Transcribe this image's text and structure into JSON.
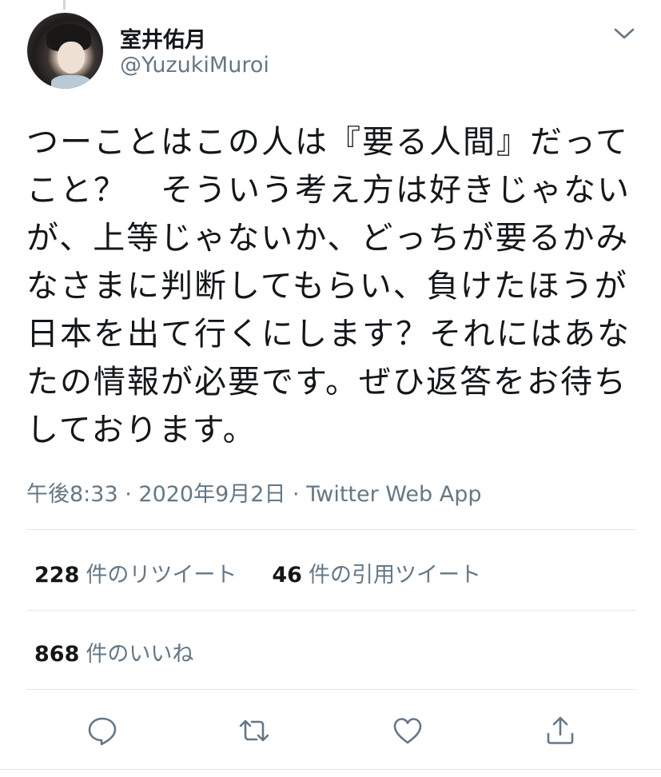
{
  "reply_context": {
    "text": "…"
  },
  "author": {
    "display_name": "室井佑月",
    "handle": "@YuzukiMuroi"
  },
  "tweet": {
    "text": "つーことはこの人は『要る人間』だってこと？　そういう考え方は好きじゃないが、上等じゃないか、どっちが要るかみなさまに判断してもらい、負けたほうが日本を出て行くにします？それにはあなたの情報が必要です。ぜひ返答をお待ちしております。",
    "time": "午後8:33",
    "separator": " · ",
    "date": "2020年9月2日",
    "source": "Twitter Web App"
  },
  "stats": {
    "retweets_count": "228",
    "retweets_label": "件のリツイート",
    "quotes_count": "46",
    "quotes_label": "件の引用ツイート",
    "likes_count": "868",
    "likes_label": "件のいいね"
  },
  "icons": {
    "more": "chevron-down-icon",
    "reply": "comment-icon",
    "retweet": "retweet-icon",
    "like": "heart-icon",
    "share": "share-icon"
  },
  "colors": {
    "text_primary": "#14171a",
    "text_secondary": "#657786",
    "divider": "#e1e8ed",
    "icon": "#657786"
  }
}
